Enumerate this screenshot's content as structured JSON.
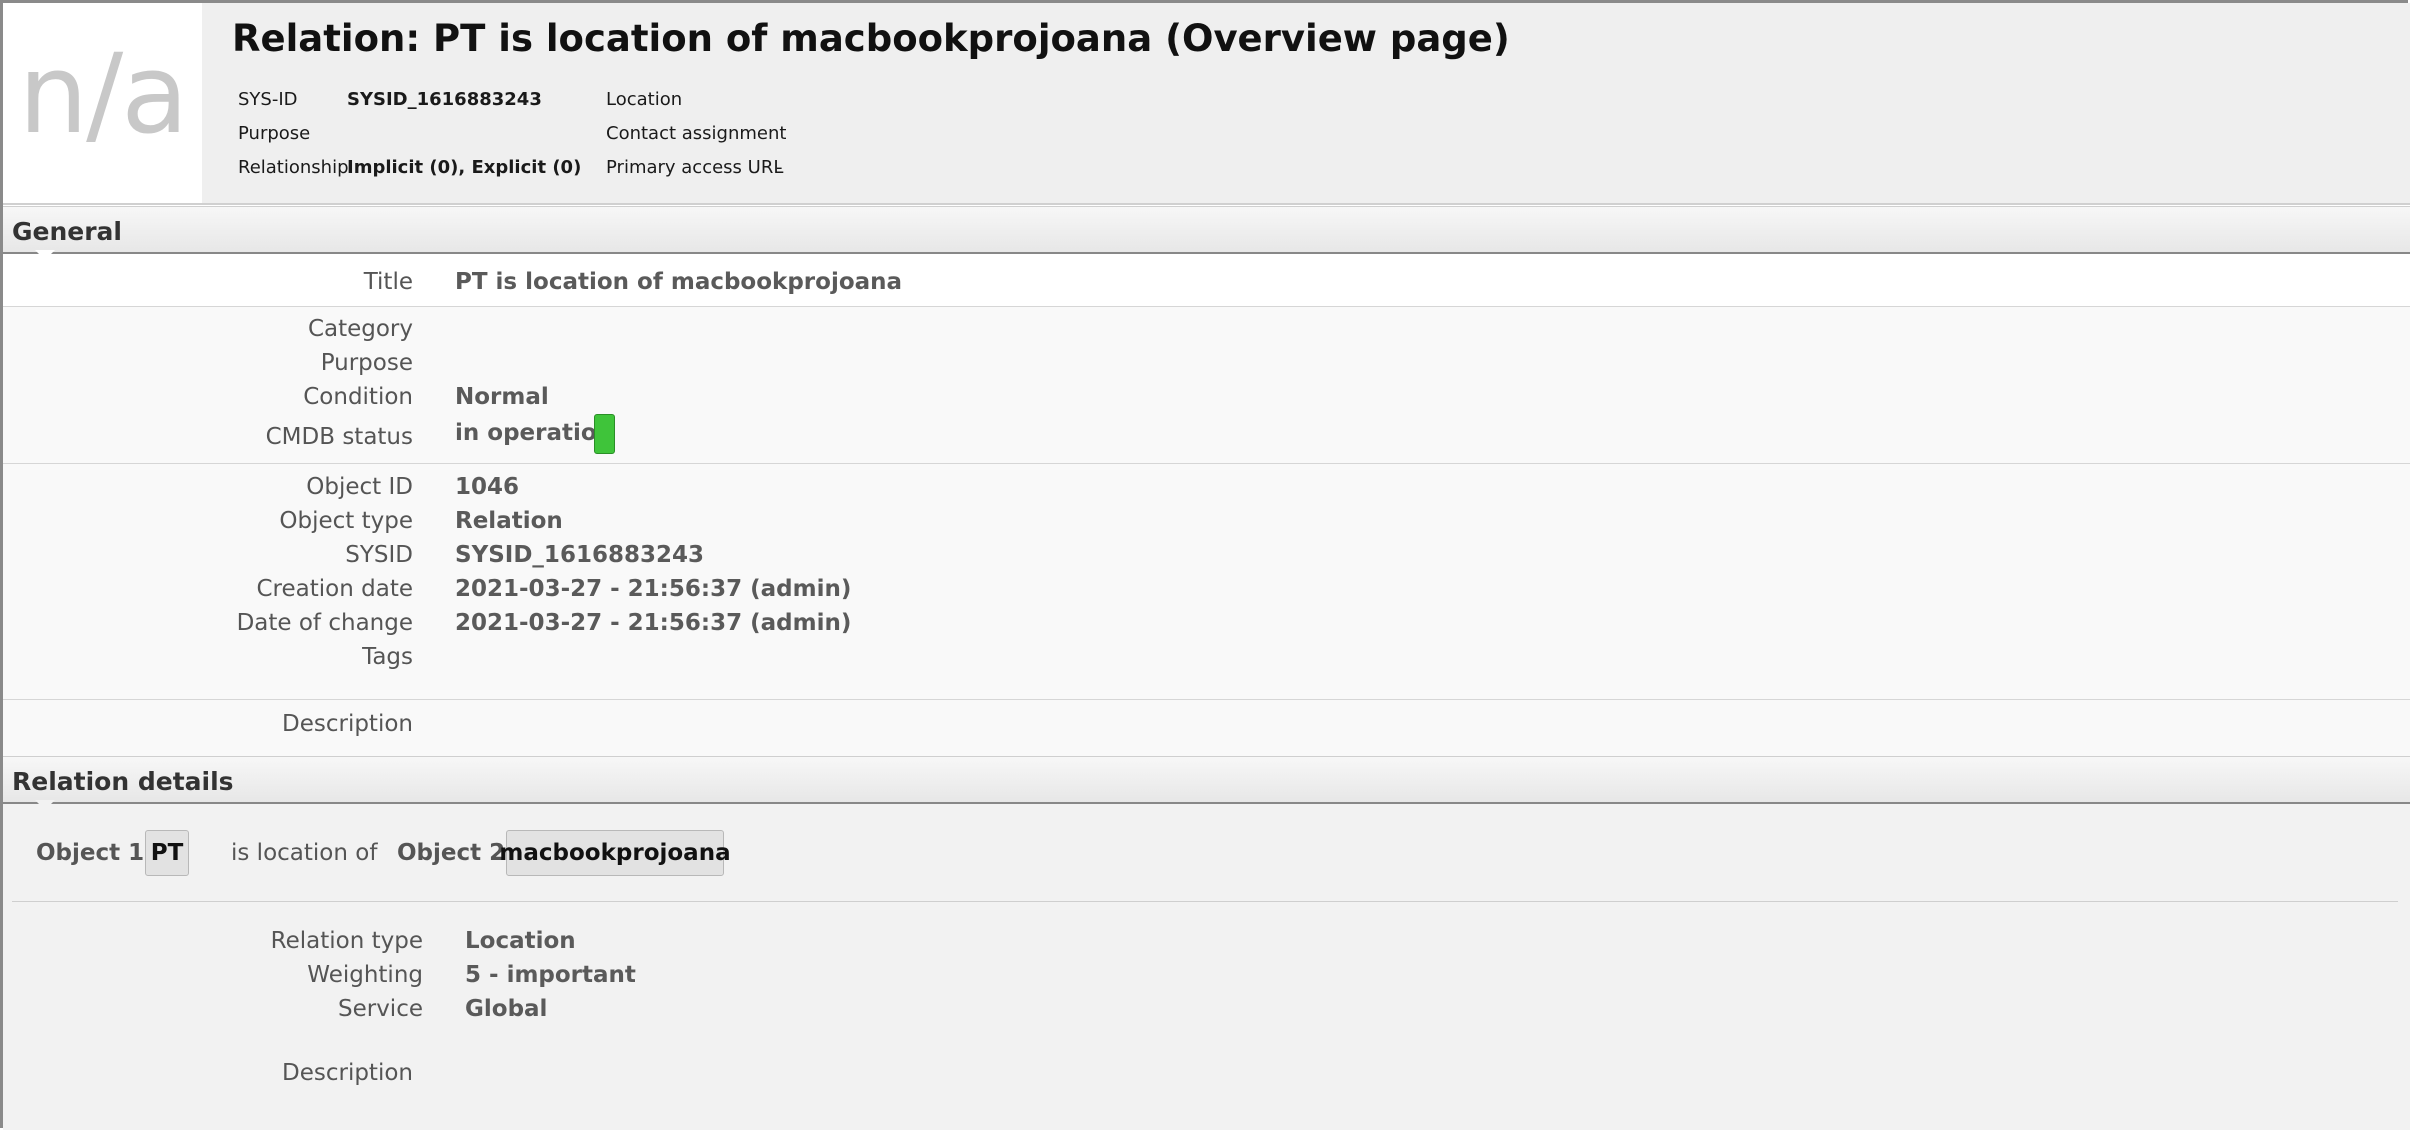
{
  "header": {
    "title": "Relation: PT is location of macbookprojoana (Overview page)",
    "thumbnail_text": "n/a",
    "meta_left": [
      {
        "label": "SYS-ID",
        "value": "SYSID_1616883243"
      },
      {
        "label": "Purpose",
        "value": ""
      },
      {
        "label": "Relationship",
        "value": "Implicit (0), Explicit (0)"
      }
    ],
    "meta_right": [
      {
        "label": "Location",
        "value": ""
      },
      {
        "label": "Contact assignment",
        "value": ""
      },
      {
        "label": "Primary access URL",
        "value": "-"
      }
    ]
  },
  "general": {
    "section_label": "General",
    "title": {
      "label": "Title",
      "value": "PT is location of macbookprojoana"
    },
    "category": {
      "label": "Category",
      "value": ""
    },
    "purpose": {
      "label": "Purpose",
      "value": ""
    },
    "condition": {
      "label": "Condition",
      "value": "Normal"
    },
    "cmdb_status": {
      "label": "CMDB status",
      "value": "in operation",
      "color": "#3fc43a"
    },
    "object_id": {
      "label": "Object ID",
      "value": "1046"
    },
    "object_type": {
      "label": "Object type",
      "value": "Relation"
    },
    "sysid": {
      "label": "SYSID",
      "value": "SYSID_1616883243"
    },
    "creation_date": {
      "label": "Creation date",
      "value": "2021-03-27 - 21:56:37 (admin)"
    },
    "date_of_change": {
      "label": "Date of change",
      "value": "2021-03-27 - 21:56:37 (admin)"
    },
    "tags": {
      "label": "Tags",
      "value": ""
    },
    "description": {
      "label": "Description",
      "value": ""
    }
  },
  "relation_details": {
    "section_label": "Relation details",
    "object1_label": "Object 1:",
    "object1_value": "PT",
    "relation_text": "is location of",
    "object2_label": "Object 2:",
    "object2_value": "macbookprojoana",
    "relation_type": {
      "label": "Relation type",
      "value": "Location"
    },
    "weighting": {
      "label": "Weighting",
      "value": "5 - important"
    },
    "service": {
      "label": "Service",
      "value": "Global"
    },
    "description": {
      "label": "Description",
      "value": ""
    }
  }
}
